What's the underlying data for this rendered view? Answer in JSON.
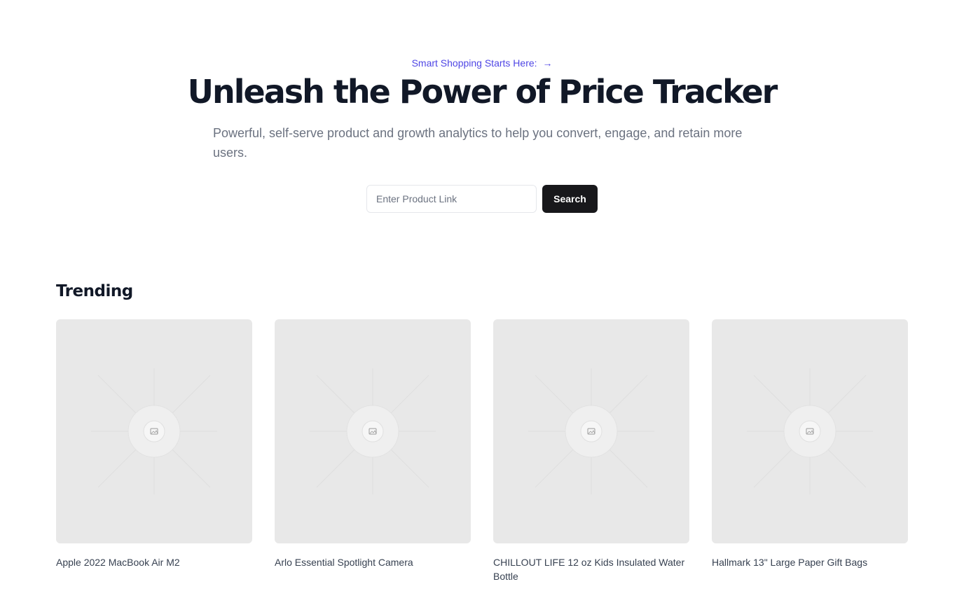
{
  "hero": {
    "eyebrow": "Smart Shopping Starts Here:",
    "eyebrow_arrow": "→",
    "headline": "Unleash the Power of Price Tracker",
    "subtext": "Powerful, self-serve product and growth analytics to help you convert, engage, and retain more users."
  },
  "search": {
    "placeholder": "Enter Product Link",
    "value": "",
    "button_label": "Search"
  },
  "trending": {
    "title": "Trending",
    "items": [
      {
        "title": "Apple 2022 MacBook Air M2",
        "image_icon": "image-placeholder-icon"
      },
      {
        "title": "Arlo Essential Spotlight Camera",
        "image_icon": "image-placeholder-icon"
      },
      {
        "title": "CHILLOUT LIFE 12 oz Kids Insulated Water Bottle",
        "image_icon": "image-placeholder-icon"
      },
      {
        "title": "Hallmark 13\" Large Paper Gift Bags",
        "image_icon": "image-placeholder-icon"
      }
    ]
  },
  "colors": {
    "accent": "#4f46e5",
    "button_bg": "#18181b",
    "placeholder_bg": "#e8e8e8",
    "heading": "#111827",
    "muted": "#6b7280"
  }
}
